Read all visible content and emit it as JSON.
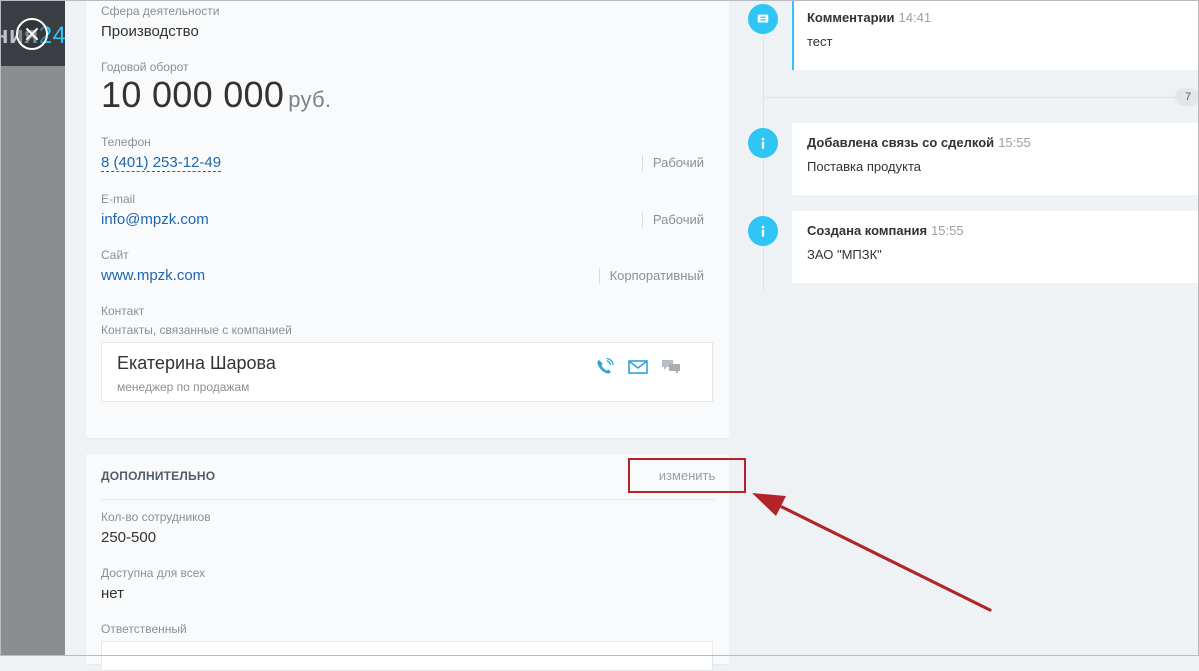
{
  "background": {
    "peek_text": "ния",
    "peek_accent": "24"
  },
  "company": {
    "sphere_label": "Сфера деятельности",
    "sphere_value": "Производство",
    "turnover_label": "Годовой оборот",
    "turnover_value": "10 000 000",
    "turnover_currency": "руб.",
    "phone_label": "Телефон",
    "phone_value": "8 (401) 253-12-49",
    "phone_type": "Рабочий",
    "email_label": "E-mail",
    "email_value": "info@mpzk.com",
    "email_type": "Рабочий",
    "site_label": "Сайт",
    "site_value": "www.mpzk.com",
    "site_type": "Корпоративный",
    "contact_label": "Контакт",
    "contact_sublabel": "Контакты, связанные с компанией",
    "contact": {
      "name": "Екатерина Шарова",
      "position": "менеджер по продажам"
    }
  },
  "extra": {
    "title": "ДОПОЛНИТЕЛЬНО",
    "edit_label": "изменить",
    "employees_label": "Кол-во сотрудников",
    "employees_value": "250-500",
    "available_label": "Доступна для всех",
    "available_value": "нет",
    "owner_label": "Ответственный"
  },
  "timeline": {
    "badge": "7",
    "items": [
      {
        "title": "Комментарии",
        "time": "14:41",
        "text": "тест",
        "icon": "comment-icon"
      },
      {
        "title": "Добавлена связь со сделкой",
        "time": "15:55",
        "text": "Поставка продукта",
        "icon": "info-icon"
      },
      {
        "title": "Создана компания",
        "time": "15:55",
        "text": "ЗАО \"МПЗК\"",
        "icon": "info-icon"
      }
    ]
  },
  "colors": {
    "accent": "#2fc6f6",
    "link": "#2067b0",
    "annotation": "#b2242a"
  }
}
